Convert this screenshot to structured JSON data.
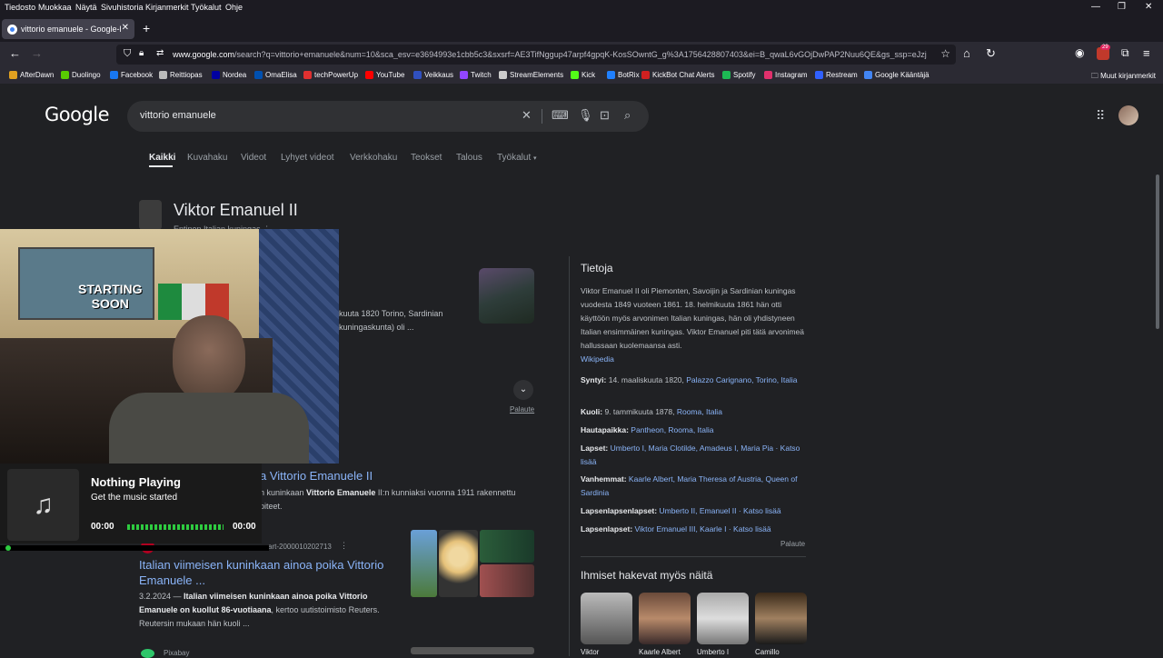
{
  "menu": [
    "Tiedosto",
    "Muokkaa",
    "Näytä",
    "Sivuhistoria",
    "Kirjanmerkit",
    "Työkalut",
    "Ohje"
  ],
  "tab": {
    "title": "vittorio emanuele - Google-haku"
  },
  "url": {
    "host": "www.google.com",
    "path": "/search?q=vittorio+emanuele&num=10&sca_esv=e3694993e1cbb5c3&sxsrf=AE3TifNggup47arpf4gpqK-KosSOwntG_g%3A1756428807403&ei=B_qwaL6vGOjDwPAP2Nuu6QE&gs_ssp=eJzj"
  },
  "ext_badge": "29",
  "bookmarks": [
    {
      "label": "AfterDawn",
      "color": "#e0a020"
    },
    {
      "label": "Duolingo",
      "color": "#58cc02"
    },
    {
      "label": "Facebook",
      "color": "#1877f2"
    },
    {
      "label": "Reittiopas",
      "color": "#bbbbbb"
    },
    {
      "label": "Nordea",
      "color": "#0000a0"
    },
    {
      "label": "OmaElisa",
      "color": "#0050b0"
    },
    {
      "label": "techPowerUp",
      "color": "#e03030"
    },
    {
      "label": "YouTube",
      "color": "#ff0000"
    },
    {
      "label": "Veikkaus",
      "color": "#3050c0"
    },
    {
      "label": "Twitch",
      "color": "#9146ff"
    },
    {
      "label": "StreamElements",
      "color": "#cccccc"
    },
    {
      "label": "Kick",
      "color": "#53fc18"
    },
    {
      "label": "BotRix",
      "color": "#2080ff"
    },
    {
      "label": "KickBot Chat Alerts",
      "color": "#d02020"
    },
    {
      "label": "Spotify",
      "color": "#1db954"
    },
    {
      "label": "Instagram",
      "color": "#e1306c"
    },
    {
      "label": "Restream",
      "color": "#3060ff"
    },
    {
      "label": "Google Kääntäjä",
      "color": "#4285f4"
    }
  ],
  "bookmarks_other": "Muut kirjanmerkit",
  "google": {
    "logo": "Google",
    "query": "vittorio emanuele",
    "tabs": [
      "Kaikki",
      "Kuvahaku",
      "Videot",
      "Lyhyet videot",
      "Verkkohaku",
      "Teokset",
      "Talous",
      "Työkalut"
    ]
  },
  "entity": {
    "title": "Viktor Emanuel II",
    "subtitle": "Entinen Italian kuningas"
  },
  "left_snippet": [
    "kuuta 1820 Torino, Sardinian",
    "kuningaskunta) oli ..."
  ],
  "feedback": "Palaute",
  "result1": {
    "title": "a Vittorio Emanuele II",
    "snippet_pre": "n kuninkaan ",
    "snippet_bold": "Vittorio Emanuele",
    "snippet_post": " II:n kunniaksi vuonna 1911 rakennettu",
    "snippet2": "piteet."
  },
  "result2": {
    "cite": "art-2000010202713",
    "title": "Italian viimeisen kuninkaan ainoa poika Vittorio Emanuele ...",
    "date": "3.2.2024 — ",
    "bold": "Italian viimeisen kuninkaan ainoa poika Vittorio Emanuele on kuollut 86-vuotiaana",
    "rest": ", kertoo uutistoimisto Reuters. Reutersin mukaan hän kuoli ..."
  },
  "result3": {
    "site": "Pixabay"
  },
  "panel": {
    "title": "Tietoja",
    "description": "Viktor Emanuel II oli Piemonten, Savoijin ja Sardinian kuningas vuodesta 1849 vuoteen 1861. 18. helmikuuta 1861 hän otti käyttöön myös arvonimen Italian kuningas, hän oli yhdistyneen Italian ensimmäinen kuningas. Viktor Emanuel piti tätä arvonimeä hallussaan kuolemaansa asti.",
    "wiki": "Wikipedia",
    "facts": [
      {
        "k": "Syntyi:",
        "v": "14. maaliskuuta 1820, ",
        "links": "Palazzo Carignano, Torino, Italia"
      },
      {
        "k": "Kuoli:",
        "v": "9. tammikuuta 1878, ",
        "links": "Rooma, Italia"
      },
      {
        "k": "Hautapaikka:",
        "v": "",
        "links": "Pantheon, Rooma, Italia"
      },
      {
        "k": "Lapset:",
        "v": "",
        "links": "Umberto I, Maria Clotilde, Amadeus I, Maria Pia · Katso lisää"
      },
      {
        "k": "Vanhemmat:",
        "v": "",
        "links": "Kaarle Albert, Maria Theresa of Austria, Queen of Sardinia"
      },
      {
        "k": "Lapsenlapsenlapset:",
        "v": "",
        "links": "Umberto II, Emanuel II · Katso lisää"
      },
      {
        "k": "Lapsenlapset:",
        "v": "",
        "links": "Viktor Emanuel III, Kaarle I · Katso lisää"
      }
    ],
    "feedback": "Palaute",
    "also_title": "Ihmiset hakevat myös näitä",
    "people": [
      "Viktor",
      "Kaarle Albert",
      "Umberto I",
      "Camillo"
    ]
  },
  "webcam_poster": {
    "line1": "STARTING",
    "line2": "SOON"
  },
  "music": {
    "title": "Nothing Playing",
    "subtitle": "Get the music started",
    "time_start": "00:00",
    "time_end": "00:00"
  }
}
